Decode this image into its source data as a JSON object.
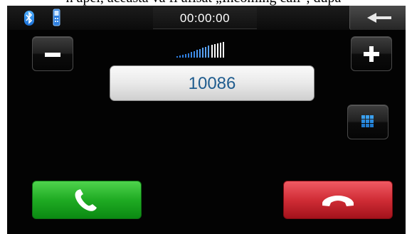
{
  "page_caption": "h apel, aceasta va fi afisat „Incoming call\", dupa",
  "status_bar": {
    "call_timer": "00:00:00",
    "bluetooth_icon": "bluetooth-icon",
    "phone_icon": "phone-icon",
    "back_icon": "back-arrow-icon"
  },
  "dialer": {
    "number": "10086",
    "volume_down_icon": "minus-icon",
    "volume_up_icon": "plus-icon",
    "signal_icon": "volume-level-icon",
    "keypad_icon": "keypad-icon"
  },
  "actions": {
    "answer_icon": "phone-answer-icon",
    "hangup_icon": "phone-hangup-icon",
    "answer_color": "#1fab23",
    "hangup_color": "#d02d36"
  },
  "colors": {
    "screen_background": "#030303",
    "number_text": "#1f5c8e"
  }
}
